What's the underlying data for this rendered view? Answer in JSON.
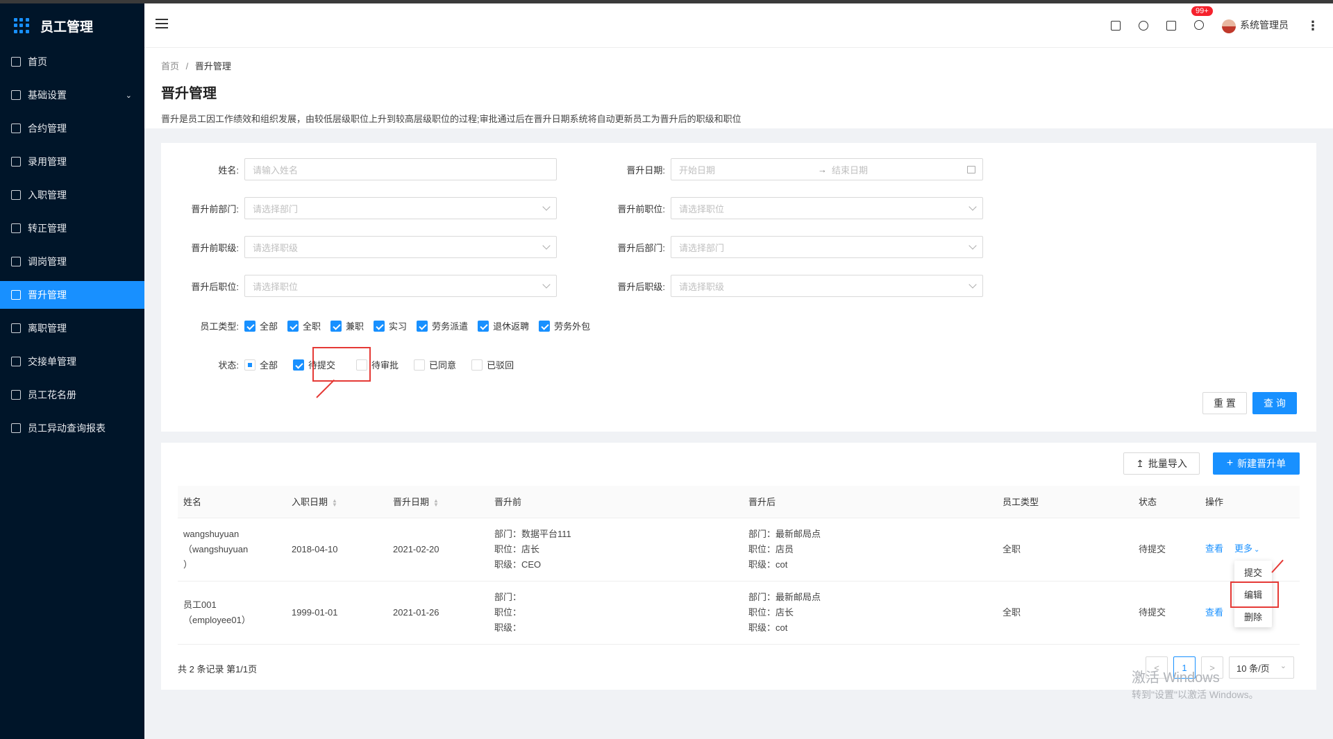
{
  "app": {
    "title": "员工管理"
  },
  "sidebar": {
    "items": [
      {
        "label": "首页"
      },
      {
        "label": "基础设置"
      },
      {
        "label": "合约管理"
      },
      {
        "label": "录用管理"
      },
      {
        "label": "入职管理"
      },
      {
        "label": "转正管理"
      },
      {
        "label": "调岗管理"
      },
      {
        "label": "晋升管理"
      },
      {
        "label": "离职管理"
      },
      {
        "label": "交接单管理"
      },
      {
        "label": "员工花名册"
      },
      {
        "label": "员工异动查询报表"
      }
    ]
  },
  "header": {
    "badge": "99+",
    "user": "系统管理员"
  },
  "page": {
    "breadcrumb_home": "首页",
    "breadcrumb_sep": "/",
    "breadcrumb_current": "晋升管理",
    "title": "晋升管理",
    "description": "晋升是员工因工作绩效和组织发展，由较低层级职位上升到较高层级职位的过程;审批通过后在晋升日期系统将自动更新员工为晋升后的职级和职位"
  },
  "filters": {
    "name_label": "姓名:",
    "name_placeholder": "请输入姓名",
    "date_label": "晋升日期:",
    "date_start": "开始日期",
    "date_arrow": "→",
    "date_end": "结束日期",
    "pre_dept_label": "晋升前部门:",
    "pre_dept_placeholder": "请选择部门",
    "pre_pos_label": "晋升前职位:",
    "pre_pos_placeholder": "请选择职位",
    "pre_level_label": "晋升前职级:",
    "pre_level_placeholder": "请选择职级",
    "post_dept_label": "晋升后部门:",
    "post_dept_placeholder": "请选择部门",
    "post_pos_label": "晋升后职位:",
    "post_pos_placeholder": "请选择职位",
    "post_level_label": "晋升后职级:",
    "post_level_placeholder": "请选择职级",
    "emp_type_label": "员工类型:",
    "emp_types": [
      "全部",
      "全职",
      "兼职",
      "实习",
      "劳务派遣",
      "退休返聘",
      "劳务外包"
    ],
    "status_label": "状态:",
    "statuses": [
      "全部",
      "待提交",
      "待审批",
      "已同意",
      "已驳回"
    ],
    "reset": "重 置",
    "query": "查 询"
  },
  "toolbar": {
    "import": "批量导入",
    "new": "新建晋升单"
  },
  "table": {
    "columns": [
      "姓名",
      "入职日期",
      "晋升日期",
      "晋升前",
      "晋升后",
      "员工类型",
      "状态",
      "操作"
    ],
    "rows": [
      {
        "name1": "wangshuyuan",
        "name2": "（wangshuyuan",
        "name3": "）",
        "hire_date": "2018-04-10",
        "promo_date": "2021-02-20",
        "before": [
          "部门：数据平台111",
          "职位：店长",
          "职级：CEO"
        ],
        "after": [
          "部门：最新邮局点",
          "职位：店员",
          "职级：cot"
        ],
        "type": "全职",
        "status": "待提交",
        "view": "查看",
        "more": "更多"
      },
      {
        "name1": "员工001",
        "name2": "（employee01）",
        "name3": "",
        "hire_date": "1999-01-01",
        "promo_date": "2021-01-26",
        "before": [
          "部门：",
          "职位：",
          "职级："
        ],
        "after": [
          "部门：最新邮局点",
          "职位：店长",
          "职级：cot"
        ],
        "type": "全职",
        "status": "待提交",
        "view": "查看",
        "more": ""
      }
    ]
  },
  "dropdown": {
    "items": [
      "提交",
      "编辑",
      "删除"
    ]
  },
  "pagination": {
    "summary": "共 2 条记录 第1/1页",
    "prev": "<",
    "page": "1",
    "next": ">",
    "size": "10 条/页"
  },
  "watermark": {
    "line1": "激活 Windows",
    "line2": "转到\"设置\"以激活 Windows。"
  },
  "colors": {
    "primary": "#1890ff",
    "sidebar": "#001529",
    "highlight": "#e53935"
  }
}
